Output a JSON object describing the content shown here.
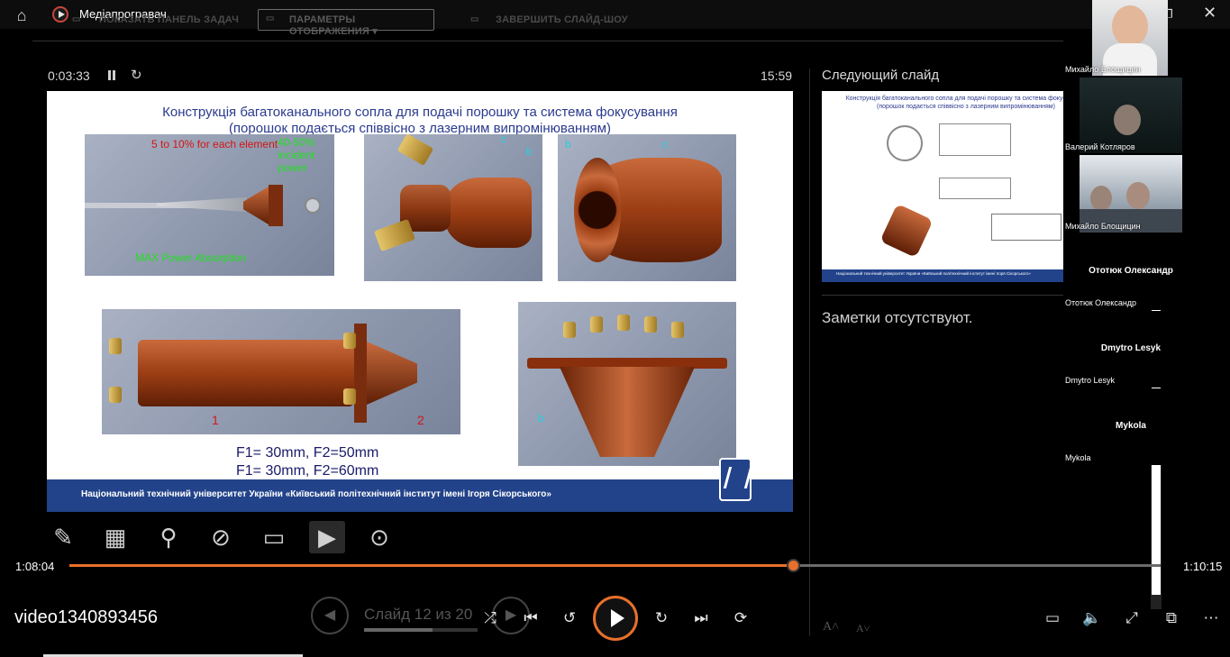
{
  "window": {
    "title": "Медіапрогравач"
  },
  "presenter": {
    "toolbar": {
      "taskbar_label": "ПОКАЗАТЬ ПАНЕЛЬ ЗАДАЧ",
      "display_label": "ПАРАМЕТРЫ ОТОБРАЖЕНИЯ ▾",
      "end_label": "ЗАВЕРШИТЬ СЛАЙД-ШОУ"
    },
    "elapsed": "0:03:33",
    "clock": "15:59",
    "next_slide_label": "Следующий слайд",
    "notes": "Заметки отсутствуют.",
    "slide_counter": "Слайд 12 из 20",
    "slide_progress": 0.6
  },
  "slide": {
    "title_line1": "Конструкція багатоканального сопла для подачі порошку та система фокусування",
    "title_line2": "(порошок подається співвісно з лазерним випромінюванням)",
    "annot_red": "5 to 10% for each element",
    "annot_green_top": "40-50% incident power",
    "annot_green_bottom": "MAX Power Absorption",
    "label_c1": "c",
    "label_b1": "b",
    "label_b2": "b",
    "label_c2": "c",
    "label_1": "1",
    "label_2": "2",
    "label_b3": "b",
    "formula_line1": "F1= 30mm,  F2=50mm",
    "formula_line2": "F1= 30mm,  F2=60mm",
    "footer": "Національний технічний університет України «Київський політехнічний інститут імені Ігоря Сікорського»"
  },
  "next_slide": {
    "title_line1": "Конструкція багатоканального сопла для подачі порошку та система фокусування",
    "title_line2": "(порошок подається співвісно з лазерним випромінюванням)",
    "footer": "Національний технічний університет України «Київський політехнічний інститут імені Ігоря Сікорського»"
  },
  "participants": [
    {
      "name": "Михайло Блощицин",
      "type": "video"
    },
    {
      "name": "Валерий Котляров",
      "type": "video"
    },
    {
      "name": "Михайло Блощицин",
      "type": "video"
    },
    {
      "title": "Ототюк Олександр",
      "name": "Ототюк Олександр",
      "type": "audio"
    },
    {
      "title": "Dmytro Lesyk",
      "name": "Dmytro Lesyk",
      "type": "audio"
    },
    {
      "title": "Mykola",
      "name": "Mykola",
      "type": "audio"
    }
  ],
  "player": {
    "position": "1:08:04",
    "duration": "1:10:15",
    "progress": 0.664,
    "video_title": "video1340893456"
  },
  "icons": {
    "home": "home-icon",
    "restore": "restore-icon",
    "close": "close-icon",
    "pen": "pen-icon",
    "all_slides": "all-slides-icon",
    "zoom": "magnifier-icon",
    "black_screen": "black-screen-icon",
    "subtitles": "subtitles-icon",
    "camera": "camera-icon",
    "more": "more-icon",
    "shuffle": "shuffle-icon",
    "prev": "skip-previous-icon",
    "rewind": "rewind-10-icon",
    "play": "play-icon",
    "forward": "forward-30-icon",
    "next": "skip-next-icon",
    "repeat": "repeat-icon",
    "captions": "captions-icon",
    "volume": "volume-icon",
    "fullscreen": "fullscreen-icon",
    "miniplayer": "miniplayer-icon",
    "options": "more-options-icon"
  },
  "colors": {
    "accent": "#e9702b",
    "slide_footer": "#22438a",
    "slide_title": "#2a3a8e"
  }
}
